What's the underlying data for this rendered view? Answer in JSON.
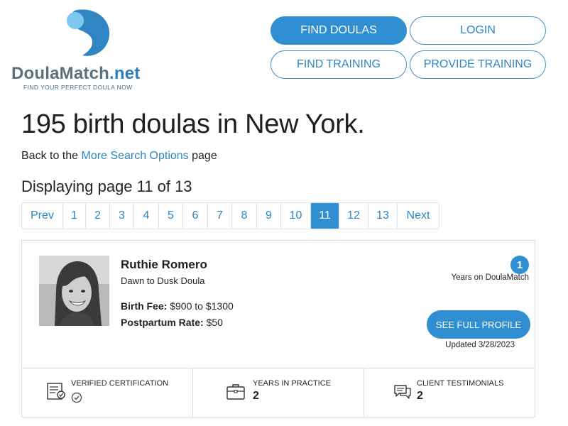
{
  "brand": {
    "name_main": "DoulaMatch",
    "name_tld": ".net",
    "tagline": "FIND YOUR PERFECT DOULA NOW",
    "colors": {
      "primary": "#2f8fd2",
      "link": "#2f86c3",
      "logo_text": "#5b6f7c"
    }
  },
  "nav": {
    "find_doulas": "FIND DOULAS",
    "login": "LOGIN",
    "find_training": "FIND TRAINING",
    "provide_training": "PROVIDE TRAINING"
  },
  "page": {
    "title": "195 birth doulas in New York.",
    "back_prefix": "Back to the ",
    "back_link": "More Search Options",
    "back_suffix": " page",
    "displaying": "Displaying page 11 of 13"
  },
  "pagination": {
    "prev": "Prev",
    "next": "Next",
    "pages": [
      "1",
      "2",
      "3",
      "4",
      "5",
      "6",
      "7",
      "8",
      "9",
      "10",
      "11",
      "12",
      "13"
    ],
    "current": "11"
  },
  "doula": {
    "name": "Ruthie Romero",
    "business": "Dawn to Dusk Doula",
    "birth_fee_label": "Birth Fee:",
    "birth_fee_value": "$900 to $1300",
    "postpartum_label": "Postpartum Rate:",
    "postpartum_value": "$50",
    "years_on_site": "1",
    "years_on_site_label": "Years on DoulaMatch",
    "profile_button": "SEE FULL PROFILE",
    "updated": "Updated 3/28/2023"
  },
  "stats": {
    "certification_label": "VERIFIED CERTIFICATION",
    "certification_icon": "check-circle-icon",
    "years_label": "YEARS IN PRACTICE",
    "years_value": "2",
    "testimonials_label": "CLIENT TESTIMONIALS",
    "testimonials_value": "2"
  }
}
